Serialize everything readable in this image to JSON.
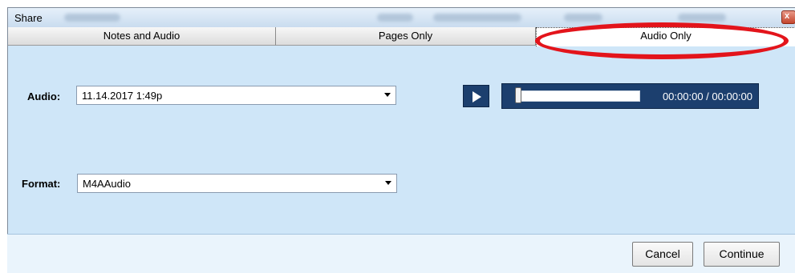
{
  "window": {
    "title": "Share",
    "close_label": "x"
  },
  "tabs": [
    {
      "label": "Notes and Audio",
      "active": false
    },
    {
      "label": "Pages Only",
      "active": false
    },
    {
      "label": "Audio Only",
      "active": true
    }
  ],
  "audio": {
    "label": "Audio:",
    "selected": "11.14.2017 1:49p"
  },
  "player": {
    "time": "00:00:00 / 00:00:00",
    "progress": 0
  },
  "format": {
    "label": "Format:",
    "selected": "M4AAudio"
  },
  "footer": {
    "cancel_label": "Cancel",
    "continue_label": "Continue"
  },
  "colors": {
    "highlight": "#e3141b",
    "player_bg": "#1c3f6e",
    "panel_bg": "#cfe6f8"
  }
}
